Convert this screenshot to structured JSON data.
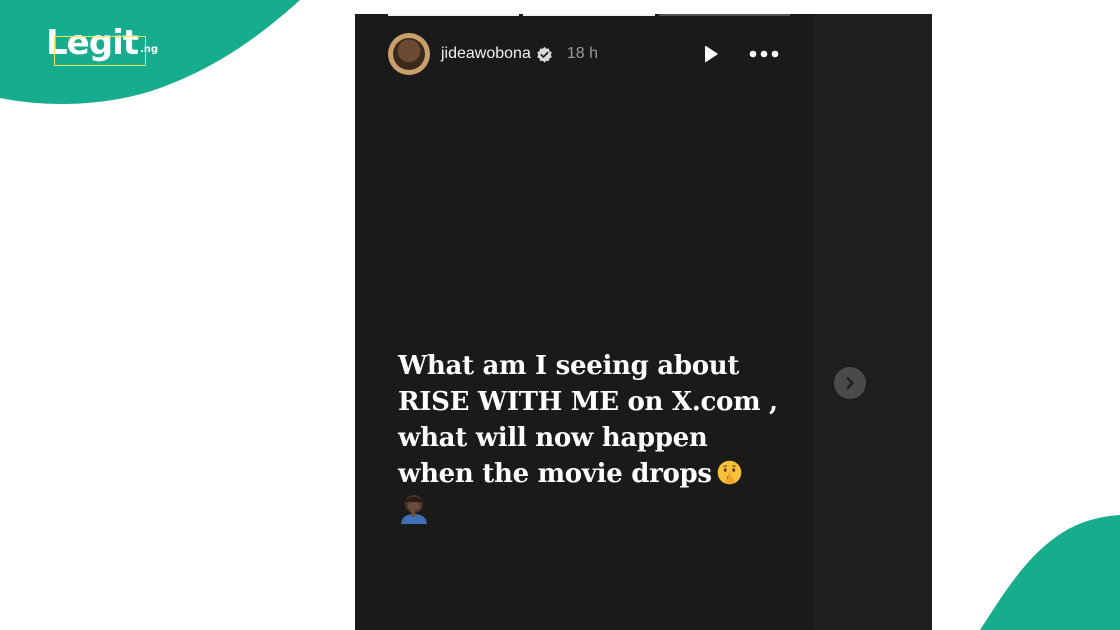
{
  "brand": {
    "logo_text": "Legit",
    "logo_tld": ".ng",
    "accent_color": "#16ad8e",
    "box_color": "#f4e25a"
  },
  "story": {
    "username": "jideawobona",
    "verified": true,
    "timestamp": "18 h",
    "progress": {
      "segments": 3,
      "active_segment": 2
    },
    "text_lines": [
      "What am I seeing about",
      "RISE WITH ME on X.com ,",
      "what will now happen",
      "when the movie drops"
    ],
    "emojis": [
      "shushing-face-emoji",
      "facepalm-emoji"
    ]
  },
  "controls": {
    "play": "play-icon",
    "more": "more-options-icon",
    "next": "chevron-right-icon"
  }
}
